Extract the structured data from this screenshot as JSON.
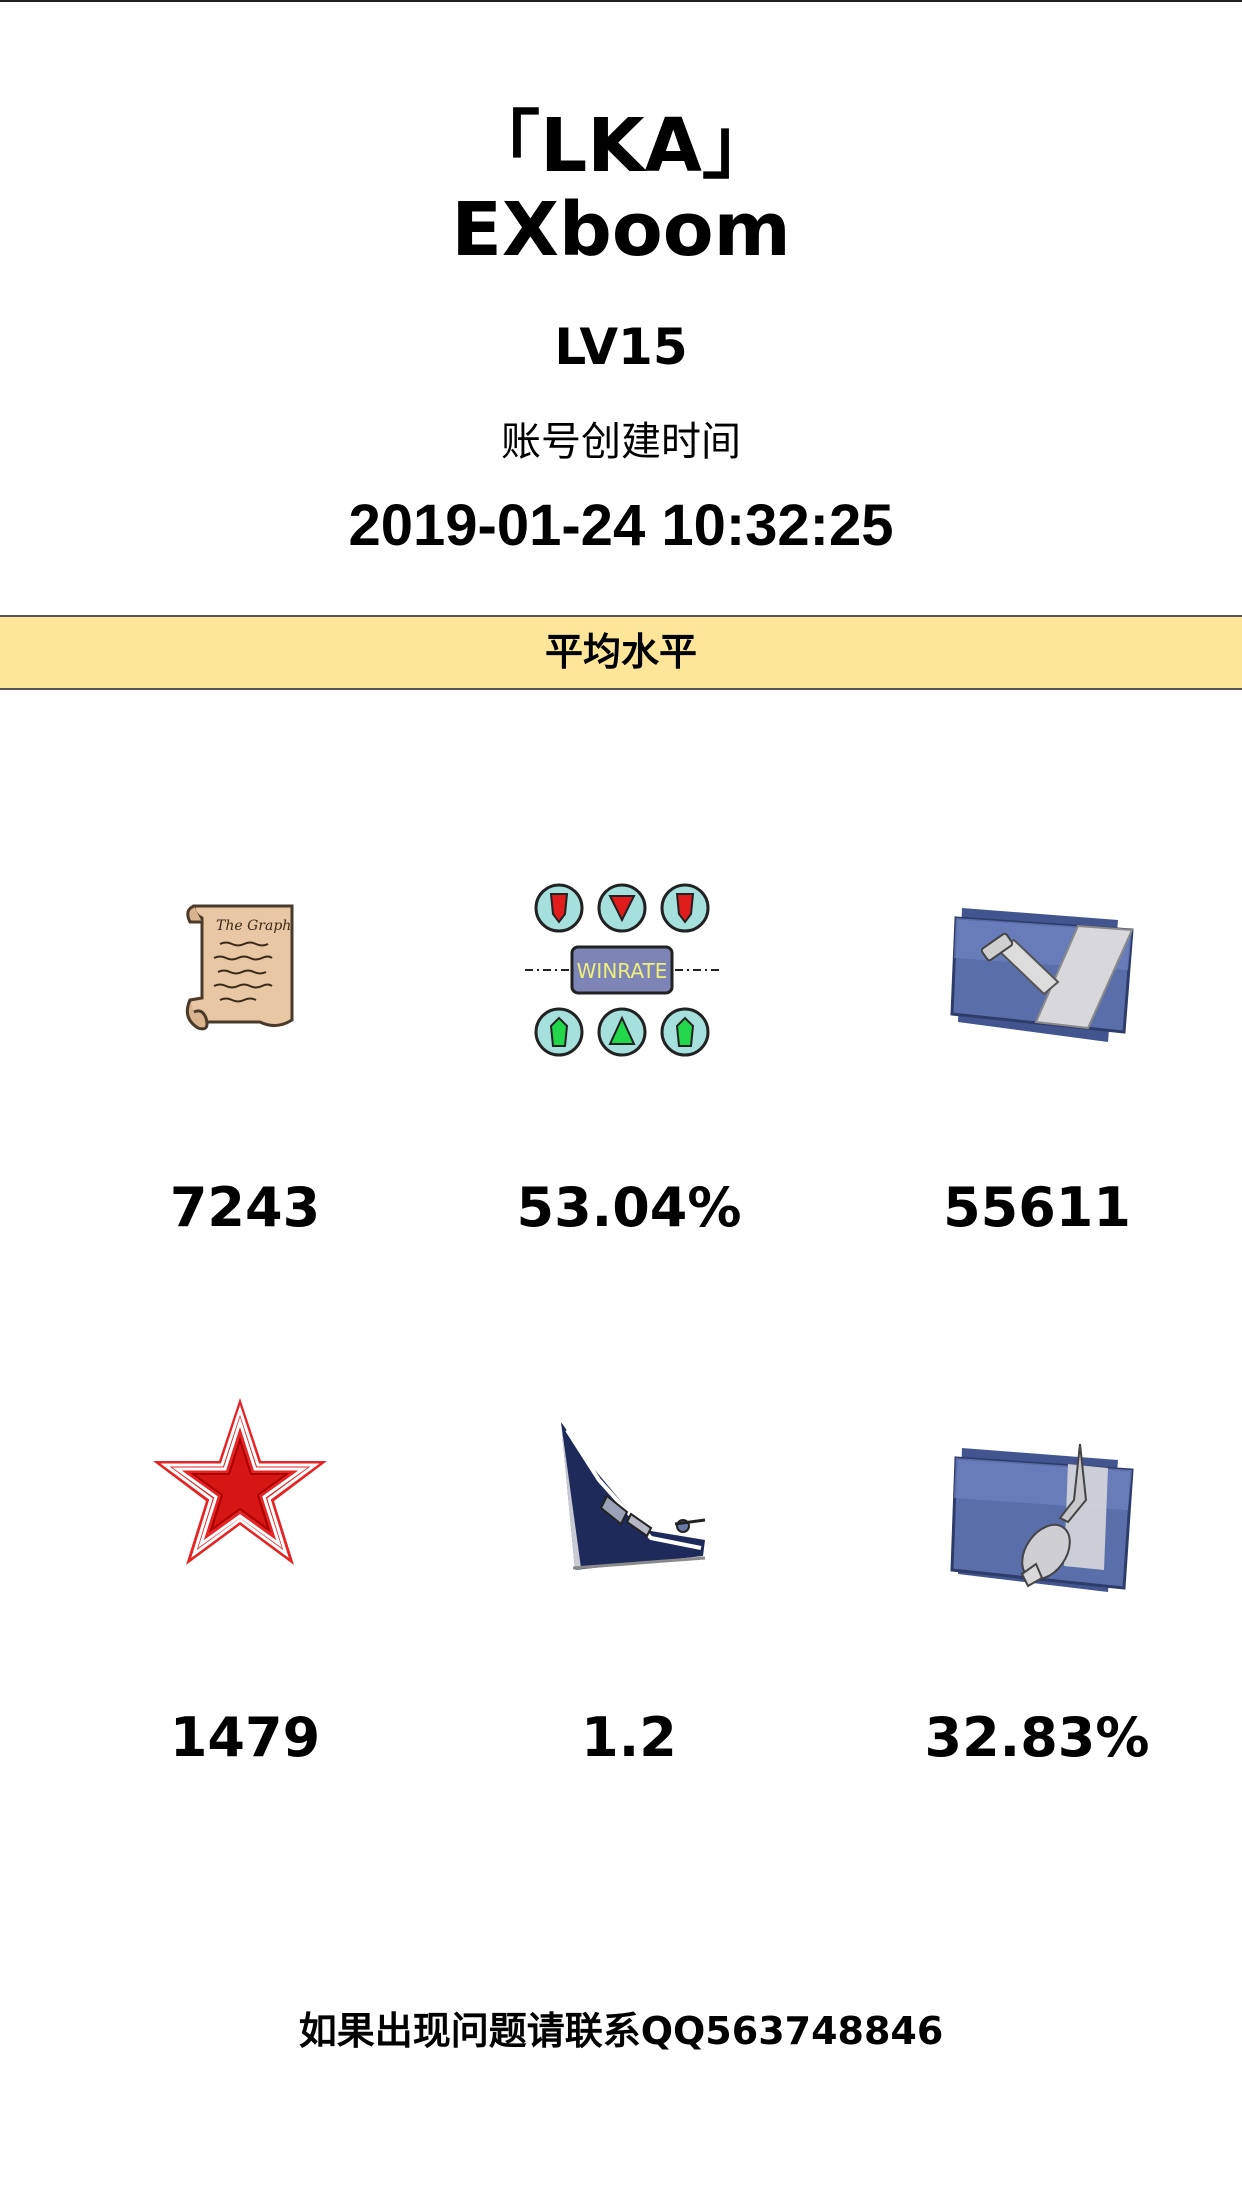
{
  "header": {
    "clan_tag": "「LKA」",
    "player_name": "EXboom",
    "level": "LV15",
    "created_label": "账号创建时间",
    "created_value": "2019-01-24 10:32:25"
  },
  "banner": {
    "label": "平均水平",
    "color": "#fde69a"
  },
  "stats": [
    {
      "icon": "battles-scroll-icon",
      "value": "7243"
    },
    {
      "icon": "winrate-icon",
      "icon_text": "WINRATE",
      "value": "53.04%"
    },
    {
      "icon": "damage-medal-icon",
      "value": "55611"
    },
    {
      "icon": "red-star-icon",
      "value": "1479"
    },
    {
      "icon": "sinking-ship-icon",
      "value": "1.2"
    },
    {
      "icon": "hit-rate-medal-icon",
      "value": "32.83%"
    }
  ],
  "footer": {
    "contact": "如果出现问题请联系QQ563748846"
  }
}
